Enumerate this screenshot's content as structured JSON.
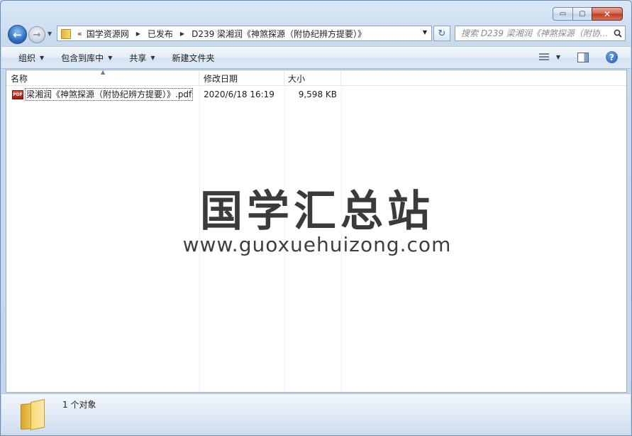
{
  "window": {
    "caption": {
      "minimize_glyph": "▭",
      "maximize_glyph": "▢",
      "close_glyph": "✕"
    }
  },
  "navigation": {
    "back_glyph": "←",
    "forward_glyph": "→",
    "overflow": "«",
    "breadcrumbs": [
      "国学资源网",
      "已发布",
      "D239 梁湘润《神煞探源（附协纪辨方提要）》"
    ],
    "refresh_glyph": "↻"
  },
  "search": {
    "placeholder": "搜索 D239 梁湘润《神煞探源（附协..."
  },
  "toolbar": {
    "organize": "组织",
    "include_in_library": "包含到库中",
    "share": "共享",
    "new_folder": "新建文件夹"
  },
  "columns": {
    "name": "名称",
    "date_modified": "修改日期",
    "size": "大小"
  },
  "files": [
    {
      "icon": "pdf-icon",
      "icon_text": "PDF",
      "name": "梁湘润《神煞探源（附协纪辨方提要）》.pdf",
      "date_modified": "2020/6/18 16:19",
      "size": "9,598 KB"
    }
  ],
  "watermark": {
    "title": "国学汇总站",
    "url": "www.guoxuehuizong.com"
  },
  "status": {
    "item_count": "1 个对象"
  },
  "colors": {
    "accent": "#2f6fbf",
    "close": "#c8452b",
    "pdf_red": "#c42a1c"
  }
}
